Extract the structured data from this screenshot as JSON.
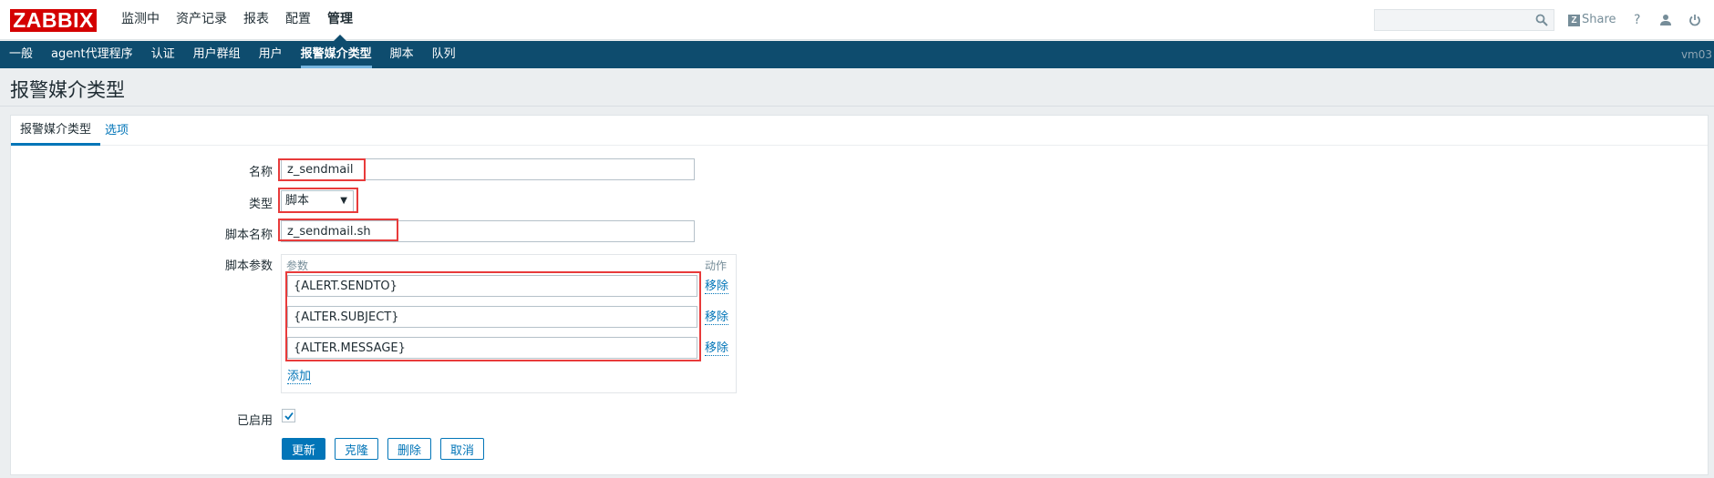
{
  "app": {
    "logo": "ZABBIX",
    "server": "vm03"
  },
  "main_nav": [
    "监测中",
    "资产记录",
    "报表",
    "配置",
    "管理"
  ],
  "main_nav_active": 4,
  "header": {
    "search_value": "",
    "share_label": "Share",
    "help_label": "?"
  },
  "sub_nav": [
    "一般",
    "agent代理程序",
    "认证",
    "用户群组",
    "用户",
    "报警媒介类型",
    "脚本",
    "队列"
  ],
  "sub_nav_active": 5,
  "page": {
    "title": "报警媒介类型"
  },
  "tabs": [
    "报警媒介类型",
    "选项"
  ],
  "form": {
    "name_label": "名称",
    "name_value": "z_sendmail",
    "type_label": "类型",
    "type_value": "脚本",
    "script_name_label": "脚本名称",
    "script_name_value": "z_sendmail.sh",
    "script_params_label": "脚本参数",
    "params_header": "参数",
    "action_header": "动作",
    "params": [
      {
        "value": "{ALERT.SENDTO}",
        "remove_label": "移除"
      },
      {
        "value": "{ALTER.SUBJECT}",
        "remove_label": "移除"
      },
      {
        "value": "{ALTER.MESSAGE}",
        "remove_label": "移除"
      }
    ],
    "add_label": "添加",
    "enabled_label": "已启用",
    "enabled": true
  },
  "buttons": {
    "update": "更新",
    "clone": "克隆",
    "delete": "删除",
    "cancel": "取消"
  },
  "colors": {
    "brand": "#d40000",
    "nav_dark": "#0e4c6e",
    "link": "#0275b8",
    "highlight": "#e83b3b"
  }
}
